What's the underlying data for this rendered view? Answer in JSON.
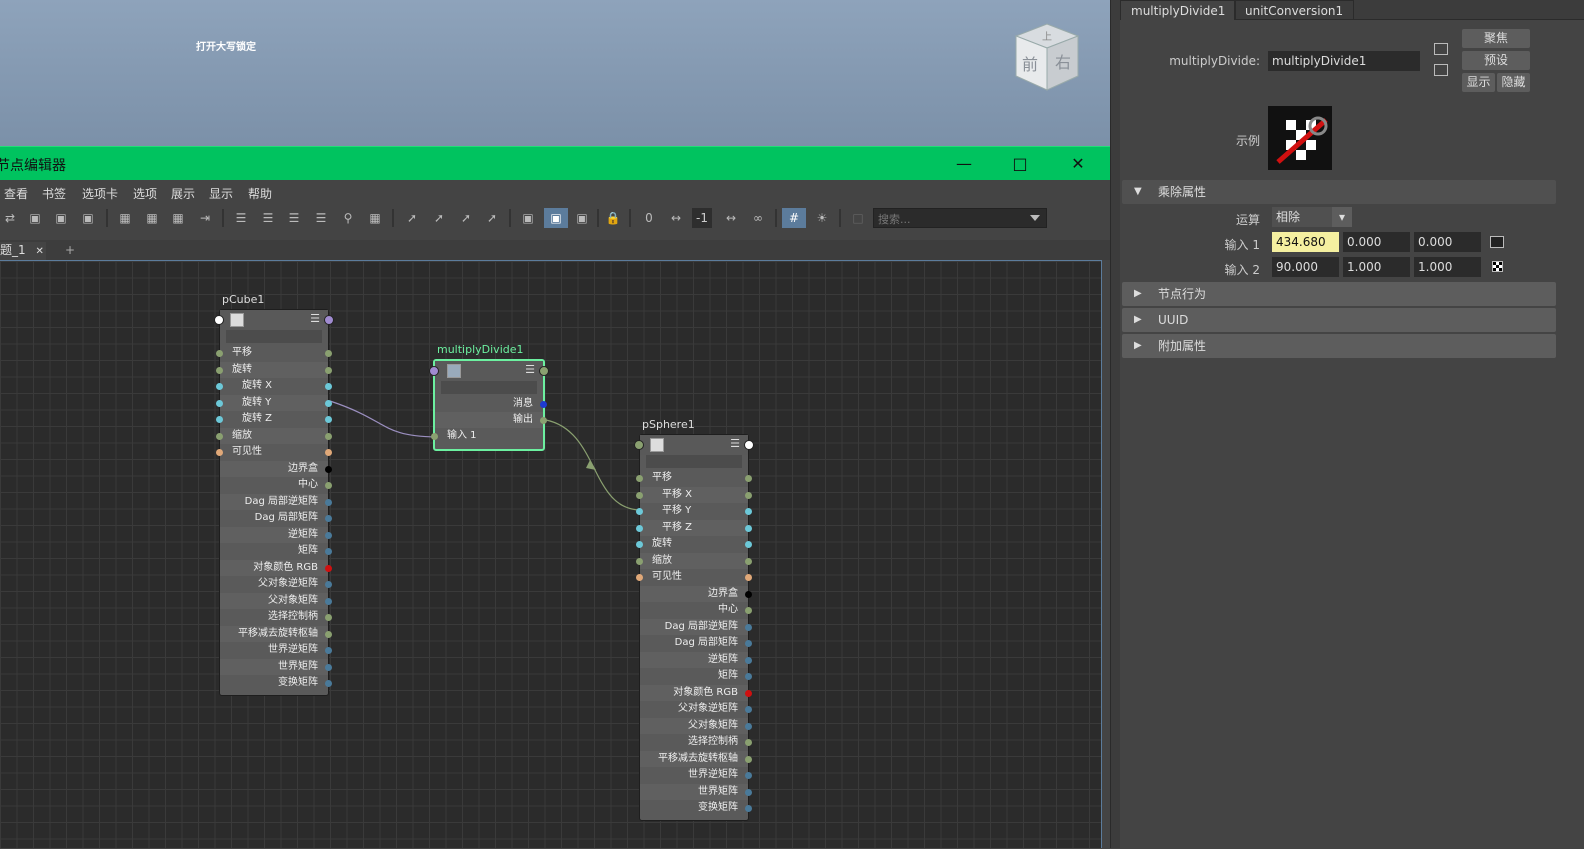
{
  "viewport": {
    "caps_lock_text": "打开大写锁定",
    "viewcube_faces": [
      "上",
      "前",
      "右"
    ]
  },
  "node_editor": {
    "title": "节点编辑器",
    "menu": [
      "查看",
      "书签",
      "选项卡",
      "选项",
      "展示",
      "显示",
      "帮助"
    ],
    "search_placeholder": "搜索...",
    "toolbar_number": "-1",
    "tab_name": "题_1",
    "tab_close": "✕",
    "tab_add": "+",
    "nodes": {
      "pcube": {
        "name": "pCube1",
        "inputs": [
          "平移",
          "旋转",
          "旋转 X",
          "旋转 Y",
          "旋转 Z",
          "缩放",
          "可见性"
        ],
        "outputs": [
          "边界盒",
          "中心",
          "Dag 局部逆矩阵",
          "Dag 局部矩阵",
          "逆矩阵",
          "矩阵",
          "对象颜色 RGB",
          "父对象逆矩阵",
          "父对象矩阵",
          "选择控制柄",
          "平移减去旋转枢轴",
          "世界逆矩阵",
          "世界矩阵",
          "变换矩阵"
        ]
      },
      "md": {
        "name": "multiplyDivide1",
        "rows": [
          "消息",
          "输出",
          "输入 1"
        ]
      },
      "psphere": {
        "name": "pSphere1",
        "inputs": [
          "平移",
          "平移 X",
          "平移 Y",
          "平移 Z",
          "旋转",
          "缩放",
          "可见性"
        ],
        "outputs": [
          "边界盒",
          "中心",
          "Dag 局部逆矩阵",
          "Dag 局部矩阵",
          "逆矩阵",
          "矩阵",
          "对象颜色 RGB",
          "父对象逆矩阵",
          "父对象矩阵",
          "选择控制柄",
          "平移减去旋转枢轴",
          "世界逆矩阵",
          "世界矩阵",
          "变换矩阵"
        ]
      }
    }
  },
  "attr_editor": {
    "tabs": [
      "multiplyDivide1",
      "unitConversion1"
    ],
    "node_label": "multiplyDivide:",
    "node_value": "multiplyDivide1",
    "buttons": {
      "focus": "聚焦",
      "presets": "预设",
      "show": "显示",
      "hide": "隐藏"
    },
    "sample_label": "示例",
    "sections": {
      "md_attrs": "乘除属性",
      "node_behavior": "节点行为",
      "uuid": "UUID",
      "extra": "附加属性"
    },
    "operation_label": "运算",
    "operation_value": "相除",
    "input1_label": "输入 1",
    "input1": [
      "434.680",
      "0.000",
      "0.000"
    ],
    "input2_label": "输入 2",
    "input2": [
      "90.000",
      "1.000",
      "1.000"
    ]
  },
  "colors": {
    "title_bar": "#00c35f",
    "highlight_field": "#f5f0a0",
    "selected_node_border": "#6cf0a0"
  }
}
